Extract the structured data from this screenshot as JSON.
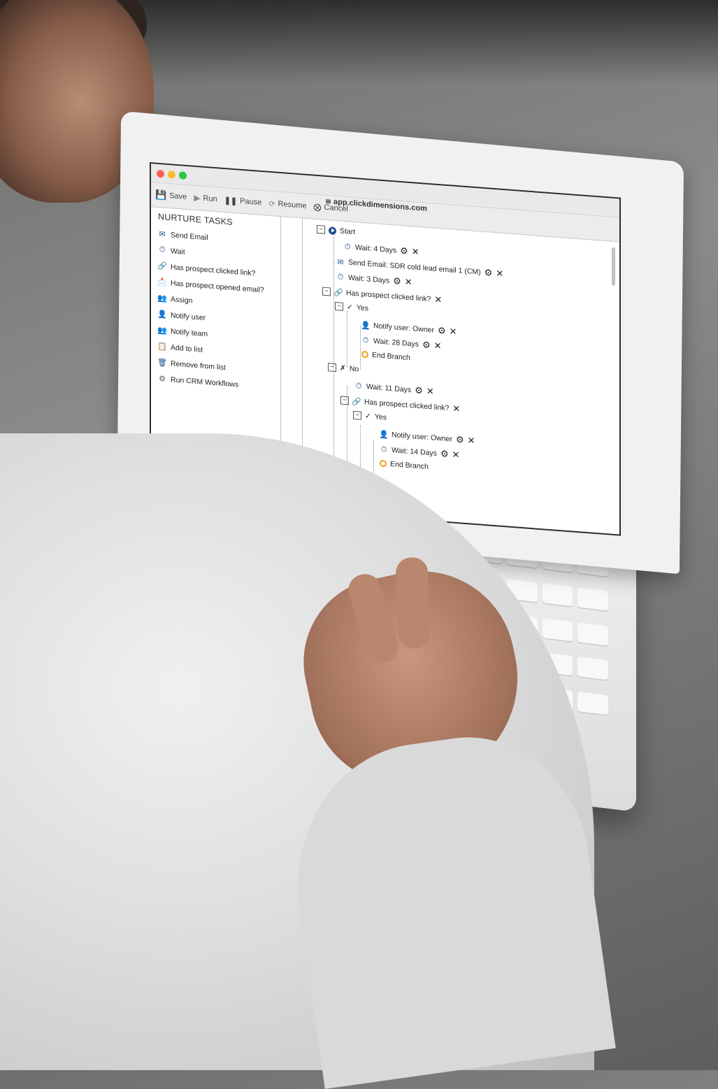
{
  "window": {
    "url": "app.clickdimensions.com",
    "traffic_lights": [
      "#ff5f57",
      "#febc2e",
      "#28c840"
    ]
  },
  "toolbar": {
    "save_label": "Save",
    "run_label": "Run",
    "pause_label": "Pause",
    "resume_label": "Resume",
    "cancel_label": "Cancel"
  },
  "sidebar": {
    "header": "NURTURE TASKS",
    "items": [
      {
        "label": "Send Email",
        "icon": "envelope-icon"
      },
      {
        "label": "Wait",
        "icon": "stopwatch-icon"
      },
      {
        "label": "Has prospect clicked link?",
        "icon": "link-icon"
      },
      {
        "label": "Has prospect opened email?",
        "icon": "open-envelope-icon"
      },
      {
        "label": "Assign",
        "icon": "assign-users-icon"
      },
      {
        "label": "Notify user",
        "icon": "notify-user-icon"
      },
      {
        "label": "Notify team",
        "icon": "notify-team-icon"
      },
      {
        "label": "Add to list",
        "icon": "add-list-icon"
      },
      {
        "label": "Remove from list",
        "icon": "remove-list-icon"
      },
      {
        "label": "Run CRM Workflows",
        "icon": "workflow-icon"
      }
    ]
  },
  "tree": {
    "start": "Start",
    "wait1": "Wait: 4 Days",
    "send_email": "Send Email: SDR cold lead email 1 (CM)",
    "wait2": "Wait: 3 Days",
    "clicked1": "Has prospect clicked link?",
    "yes1": "Yes",
    "notify1": "Notify user: Owner",
    "wait3": "Wait: 28 Days",
    "end1": "End Branch",
    "no1": "No",
    "wait4": "Wait: 11 Days",
    "clicked2": "Has prospect clicked link?",
    "yes2": "Yes",
    "notify2": "Notify user: Owner",
    "wait5": "Wait: 14 Days",
    "end2": "End Branch"
  },
  "colors": {
    "accent": "#1d4f91",
    "end_branch": "#f0a01a"
  }
}
